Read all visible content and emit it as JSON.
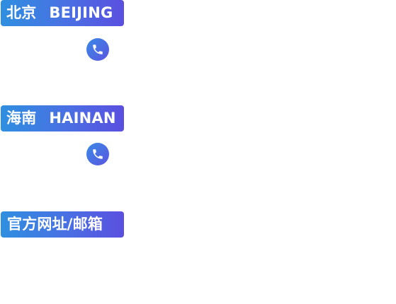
{
  "sections": [
    {
      "id": "beijing",
      "label_cn": "北京",
      "label_en": "BEIJING",
      "icon": "phone-icon"
    },
    {
      "id": "hainan",
      "label_cn": "海南",
      "label_en": "HAINAN",
      "icon": "phone-icon"
    },
    {
      "id": "web",
      "label_cn": "官方网址/邮箱"
    }
  ],
  "colors": {
    "gradient_start": "#2f8fe0",
    "gradient_end": "#5a4fe0",
    "text": "#ffffff",
    "background": "#ffffff"
  }
}
